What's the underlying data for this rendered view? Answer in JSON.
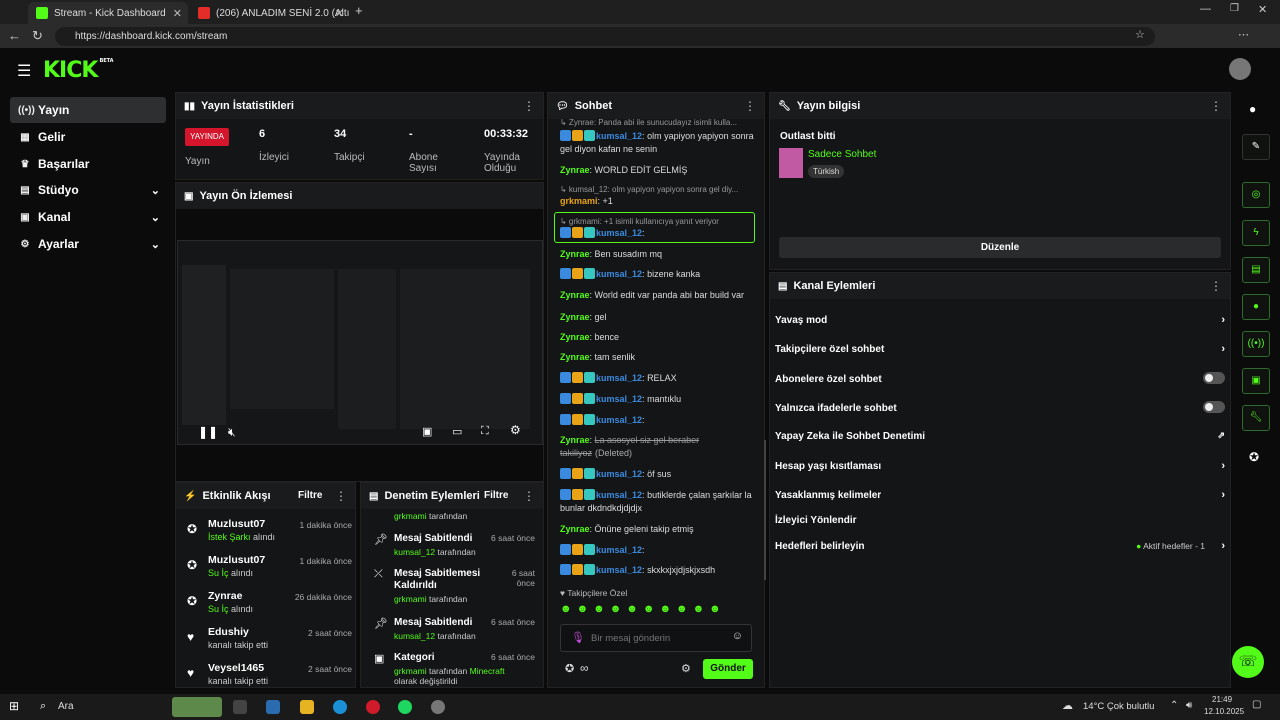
{
  "browser": {
    "tabs": [
      {
        "title": "Stream - Kick Dashboard"
      },
      {
        "title": "(206) ANLADIM SENİ 2.0 (Altında"
      }
    ],
    "url": "https://dashboard.kick.com/stream"
  },
  "brand": {
    "logo": "KICK",
    "beta": "BETA",
    "accent": "#53fc18"
  },
  "sidebar": [
    {
      "label": "Yayın",
      "icon": "broadcast-icon"
    },
    {
      "label": "Gelir",
      "icon": "chart-icon"
    },
    {
      "label": "Başarılar",
      "icon": "trophy-icon"
    },
    {
      "label": "Stüdyo",
      "icon": "studio-icon"
    },
    {
      "label": "Kanal",
      "icon": "channel-icon"
    },
    {
      "label": "Ayarlar",
      "icon": "gear-icon"
    }
  ],
  "stats": {
    "title": "Yayın İstatistikleri",
    "live_badge": "YAYINDA",
    "live_label": "Yayın",
    "viewers": {
      "value": "6",
      "label": "İzleyici"
    },
    "followers": {
      "value": "34",
      "label": "Takipçi"
    },
    "subs": {
      "value": "-",
      "label": "Abone Sayısı"
    },
    "uptime": {
      "value": "00:33:32",
      "label": "Yayında Olduğu"
    }
  },
  "preview": {
    "title": "Yayın Ön İzlemesi"
  },
  "activity": {
    "title": "Etkinlik Akışı",
    "filter": "Filtre",
    "items": [
      {
        "name": "Muzlusut07",
        "action_hl": "İstek Şarkı",
        "action": " alındı",
        "time": "1 dakika önce",
        "icon": "gift-icon"
      },
      {
        "name": "Muzlusut07",
        "action_hl": "Su İç",
        "action": " alındı",
        "time": "1 dakika önce",
        "icon": "gift-icon"
      },
      {
        "name": "Zynrae",
        "action_hl": "Su İç",
        "action": " alındı",
        "time": "26 dakika önce",
        "icon": "gift-icon"
      },
      {
        "name": "Edushiy",
        "action_hl": "",
        "action": "kanalı takip etti",
        "time": "2 saat önce",
        "icon": "heart-icon"
      },
      {
        "name": "Veysel1465",
        "action_hl": "",
        "action": "kanalı takip etti",
        "time": "2 saat önce",
        "icon": "heart-icon"
      }
    ]
  },
  "moderation": {
    "title": "Denetim Eylemleri",
    "filter": "Filtre",
    "top_line_user": "grkmami",
    "top_line_rest": " tarafından",
    "items": [
      {
        "title": "Mesaj Sabitlendi",
        "user": "kumsal_12",
        "rest": " tarafından",
        "time": "6 saat önce",
        "icon": "pin-icon"
      },
      {
        "title": "Mesaj Sabitlemesi Kaldırıldı",
        "user": "grkmami",
        "rest": " tarafından",
        "time": "6 saat önce",
        "icon": "unpin-icon"
      },
      {
        "title": "Mesaj Sabitlendi",
        "user": "kumsal_12",
        "rest": " tarafından",
        "time": "6 saat önce",
        "icon": "pin-icon"
      },
      {
        "title": "Kategori",
        "user": "grkmami",
        "rest": " tarafından ",
        "extra": "Minecraft",
        "extra2": "olarak değiştirildi",
        "time": "6 saat önce",
        "icon": "category-icon"
      }
    ]
  },
  "chat": {
    "title": "Sohbet",
    "messages": [
      {
        "reply": "↳ Zynrae: Panda abi ile sunucudayız isimli kulla..."
      },
      {
        "user": "kumsal_12",
        "color": "#3a8be0",
        "text": "olm yapiyon yapiyon sonra gel diyon kafan ne senin",
        "badges": true
      },
      {
        "user": "Zynrae",
        "color": "#53fc18",
        "text": "WORLD EDİT GELMİŞ"
      },
      {
        "reply": "↳ kumsal_12: olm yapiyon yapiyon sonra gel diy..."
      },
      {
        "user": "grkmami",
        "color": "#e8a317",
        "text": "+1"
      },
      {
        "reply": "↳ grkmami: +1 isimli kullanıcıya yanıt veriyor"
      },
      {
        "user": "kumsal_12",
        "color": "#3a8be0",
        "text": "",
        "badges": true
      },
      {
        "user": "Zynrae",
        "color": "#53fc18",
        "text": "Ben susadım mq"
      },
      {
        "user": "kumsal_12",
        "color": "#3a8be0",
        "text": "bizene kanka",
        "badges": true
      },
      {
        "user": "Zynrae",
        "color": "#53fc18",
        "text": "World edit var panda abi bar build var"
      },
      {
        "user": "Zynrae",
        "color": "#53fc18",
        "text": "gel"
      },
      {
        "user": "Zynrae",
        "color": "#53fc18",
        "text": "bence"
      },
      {
        "user": "Zynrae",
        "color": "#53fc18",
        "text": "tam senlik"
      },
      {
        "user": "kumsal_12",
        "color": "#3a8be0",
        "text": "RELAX",
        "badges": true
      },
      {
        "user": "kumsal_12",
        "color": "#3a8be0",
        "text": "mantıklu",
        "badges": true
      },
      {
        "user": "kumsal_12",
        "color": "#3a8be0",
        "text": "",
        "badges": true
      },
      {
        "user": "Zynrae",
        "color": "#53fc18",
        "text": "Lа asosyel siz gel beraber takiliyoz",
        "deleted": "(Deleted)"
      },
      {
        "user": "kumsal_12",
        "color": "#3a8be0",
        "text": "öf sus",
        "badges": true
      },
      {
        "user": "kumsal_12",
        "color": "#3a8be0",
        "text": "butiklerde çalan şarkılar la bunlar dkdndkdjdjdjx",
        "badges": true
      },
      {
        "user": "Zynrae",
        "color": "#53fc18",
        "text": "Önüne geleni takip etmiş"
      },
      {
        "user": "kumsal_12",
        "color": "#3a8be0",
        "text": "",
        "badges": true
      },
      {
        "user": "kumsal_12",
        "color": "#3a8be0",
        "text": "skxkxjxjdjskjxsdh",
        "badges": true
      }
    ],
    "followers_only": "♥ Takipçilere Özel",
    "placeholder": "Bir mesaj gönderin",
    "send": "Gönder"
  },
  "info": {
    "title": "Yayın bilgisi",
    "stream_title": "Outlast bitti",
    "category": "Sadece Sohbet",
    "language": "Türkish",
    "edit": "Düzenle"
  },
  "channel_actions": {
    "title": "Kanal Eylemleri",
    "rows": [
      {
        "label": "Yavaş mod",
        "control": "chevron"
      },
      {
        "label": "Takipçilere özel sohbet",
        "control": "chevron"
      },
      {
        "label": "Abonelere özel sohbet",
        "control": "toggle"
      },
      {
        "label": "Yalnızca ifadelerle sohbet",
        "control": "toggle"
      },
      {
        "label": "Yapay Zeka ile Sohbet Denetimi",
        "control": "external"
      },
      {
        "label": "Hesap yaşı kısıtlaması",
        "control": "chevron"
      },
      {
        "label": "Yasaklanmış kelimeler",
        "control": "chevron"
      },
      {
        "label": "İzleyici Yönlendir",
        "control": "none"
      },
      {
        "label": "Hedefleri belirleyin",
        "control": "chevron",
        "extra": "Aktif hedefler - 1"
      }
    ]
  },
  "taskbar": {
    "search": "Ara",
    "weather": "14°C  Çok bulutlu",
    "time": "21:49",
    "date": "12.10.2025"
  }
}
